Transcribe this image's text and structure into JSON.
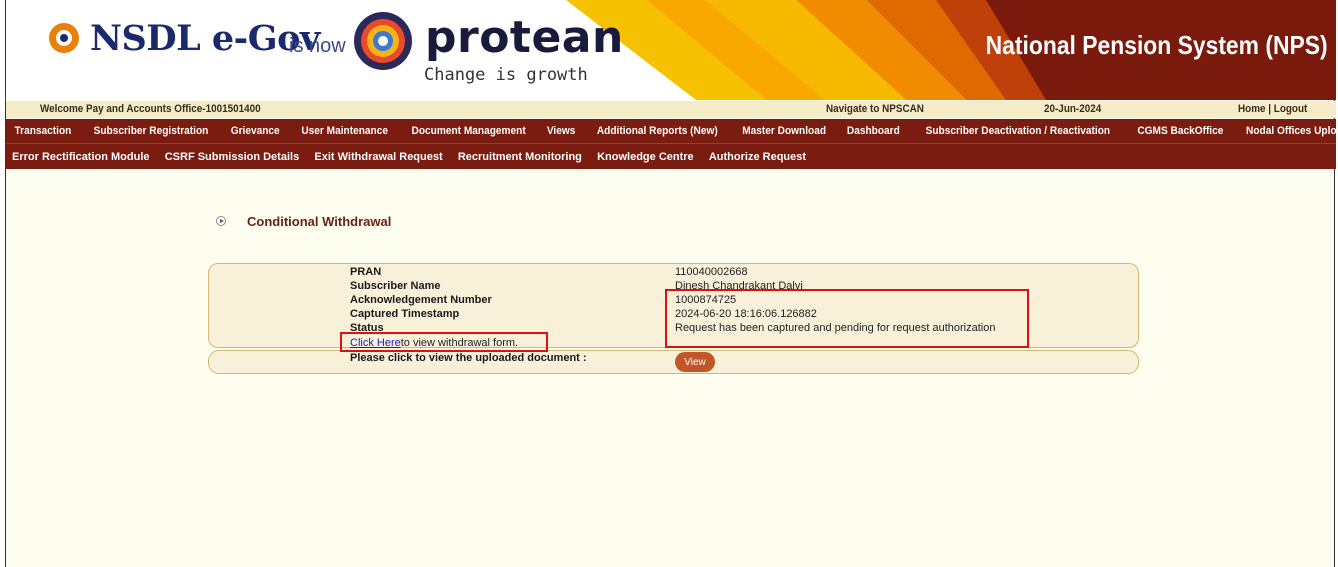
{
  "header": {
    "brand_name": "NSDL e-Gov",
    "is_now": "is now",
    "protean": "protean",
    "tagline": "Change is growth",
    "title": "National Pension System (NPS)"
  },
  "welcome_bar": {
    "welcome": "Welcome Pay and Accounts Office-1001501400",
    "navigate": "Navigate to NPSCAN",
    "date": "20-Jun-2024",
    "home_logout": "Home | Logout"
  },
  "menu_row1": [
    "Transaction",
    "Subscriber Registration",
    "Grievance",
    "User Maintenance",
    "Document Management",
    "Views",
    "Additional Reports (New)",
    "Master Download",
    "Dashboard",
    "Subscriber Deactivation / Reactivation",
    "CGMS BackOffice",
    "Nodal Offices Upload"
  ],
  "menu_row2": [
    "Error Rectification Module",
    "CSRF Submission Details",
    "Exit Withdrawal Request",
    "Recruitment Monitoring",
    "Knowledge Centre",
    "Authorize Request"
  ],
  "page": {
    "title": "Conditional Withdrawal"
  },
  "details": {
    "pran_label": "PRAN",
    "pran_value": "110040002668",
    "name_label": "Subscriber Name",
    "name_value": "Dinesh Chandrakant Dalvi",
    "ack_label": "Acknowledgement Number",
    "ack_value": "1000874725",
    "ts_label": "Captured Timestamp",
    "ts_value": "2024-06-20 18:16:06.126882",
    "status_label": "Status",
    "status_value": "Request has been captured and pending for request authorization",
    "click_here": "Click Here",
    "click_suffix": "to view withdrawal form.",
    "upload_label": "Please click to view the uploaded document :",
    "view_button": "View"
  },
  "colors": {
    "menu_bg": "#7b1c10",
    "welcome_bg": "#f5ecc8",
    "page_bg": "#fdfdf0",
    "highlight": "#e01010",
    "button": "#c0562a"
  }
}
